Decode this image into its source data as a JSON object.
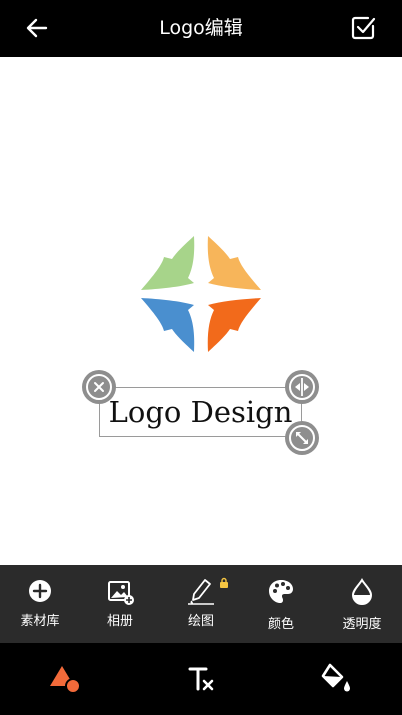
{
  "header": {
    "title": "Logo编辑"
  },
  "canvas": {
    "logo_text": "Logo Design",
    "logo_colors": [
      "#a7d48a",
      "#f7b55a",
      "#4a8fcf",
      "#f26a1b"
    ]
  },
  "toolbar": {
    "items": [
      {
        "label": "素材库",
        "icon": "plus-circle-icon"
      },
      {
        "label": "相册",
        "icon": "image-add-icon"
      },
      {
        "label": "绘图",
        "icon": "pen-icon",
        "locked": true
      },
      {
        "label": "颜色",
        "icon": "palette-icon"
      },
      {
        "label": "透明度",
        "icon": "drop-icon"
      }
    ]
  },
  "bottom_nav": {
    "items": [
      {
        "icon": "shapes-icon",
        "active": true,
        "color": "#f26a3a"
      },
      {
        "icon": "text-format-clear-icon",
        "active": false
      },
      {
        "icon": "paint-bucket-icon",
        "active": false
      }
    ]
  }
}
